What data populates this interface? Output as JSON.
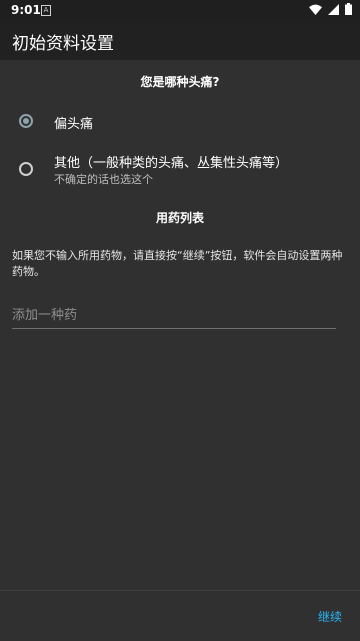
{
  "status_bar": {
    "time": "9:01",
    "notification_letter": "A",
    "icons": [
      "wifi-icon",
      "signal-icon",
      "battery-icon"
    ]
  },
  "app_bar": {
    "title": "初始资料设置"
  },
  "headache_section": {
    "title": "您是哪种头痛?",
    "options": [
      {
        "label": "偏头痛",
        "sublabel": "",
        "selected": true
      },
      {
        "label": "其他（一般种类的头痛、丛集性头痛等）",
        "sublabel": "不确定的话也选这个",
        "selected": false
      }
    ]
  },
  "medication_section": {
    "title": "用药列表",
    "help_text": "如果您不输入所用药物，请直接按“继续”按钮，软件会自动设置两种药物。",
    "input_placeholder": "添加一种药",
    "input_value": ""
  },
  "footer": {
    "continue_label": "继续"
  },
  "colors": {
    "background": "#303030",
    "app_bar": "#212121",
    "status_bar": "#1f1f1f",
    "accent": "#29b6f6",
    "radio_checked": "#8fa3ad"
  }
}
